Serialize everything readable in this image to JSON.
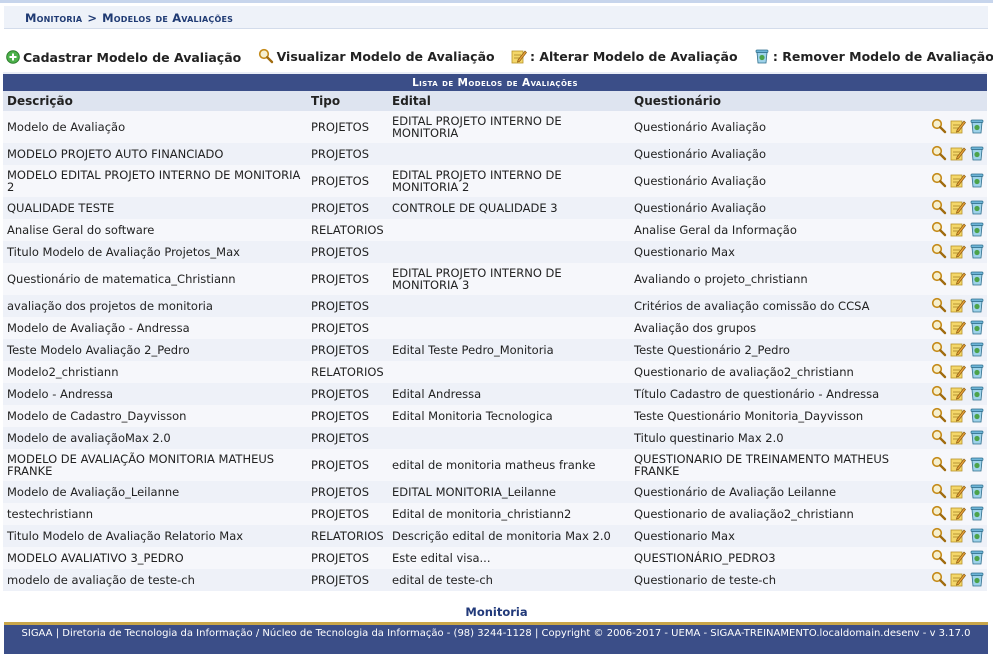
{
  "breadcrumb": {
    "module": "Monitoria",
    "separator": ">",
    "page": "Modelos de Avaliações"
  },
  "actions": {
    "register": "Cadastrar Modelo de Avaliação",
    "view": "Visualizar Modelo de Avaliação",
    "edit": ": Alterar Modelo de Avaliação",
    "remove": ": Remover Modelo de Avaliação"
  },
  "table": {
    "caption": "Lista de Modelos de Avaliações",
    "headers": {
      "descricao": "Descrição",
      "tipo": "Tipo",
      "edital": "Edital",
      "questionario": "Questionário"
    },
    "rows": [
      {
        "descricao": "Modelo de Avaliação",
        "tipo": "PROJETOS",
        "edital": "EDITAL PROJETO INTERNO DE MONITORIA",
        "questionario": "Questionário Avaliação"
      },
      {
        "descricao": "MODELO PROJETO AUTO FINANCIADO",
        "tipo": "PROJETOS",
        "edital": "",
        "questionario": "Questionário Avaliação"
      },
      {
        "descricao": "MODELO EDITAL PROJETO INTERNO DE MONITORIA 2",
        "tipo": "PROJETOS",
        "edital": "EDITAL PROJETO INTERNO DE MONITORIA 2",
        "questionario": "Questionário Avaliação"
      },
      {
        "descricao": "QUALIDADE TESTE",
        "tipo": "PROJETOS",
        "edital": "CONTROLE DE QUALIDADE 3",
        "questionario": "Questionário Avaliação"
      },
      {
        "descricao": "Analise Geral do software",
        "tipo": "RELATORIOS",
        "edital": "",
        "questionario": "Analise Geral da Informação"
      },
      {
        "descricao": "Titulo Modelo de Avaliação Projetos_Max",
        "tipo": "PROJETOS",
        "edital": "",
        "questionario": "Questionario Max"
      },
      {
        "descricao": "Questionário de matematica_Christiann",
        "tipo": "PROJETOS",
        "edital": "EDITAL PROJETO INTERNO DE MONITORIA 3",
        "questionario": "Avaliando o projeto_christiann"
      },
      {
        "descricao": "avaliação dos projetos de monitoria",
        "tipo": "PROJETOS",
        "edital": "",
        "questionario": "Critérios de avaliação comissão do CCSA"
      },
      {
        "descricao": "Modelo de Avaliação - Andressa",
        "tipo": "PROJETOS",
        "edital": "",
        "questionario": "Avaliação dos grupos"
      },
      {
        "descricao": "Teste Modelo Avaliação 2_Pedro",
        "tipo": "PROJETOS",
        "edital": "Edital Teste Pedro_Monitoria",
        "questionario": "Teste Questionário 2_Pedro"
      },
      {
        "descricao": "Modelo2_christiann",
        "tipo": "RELATORIOS",
        "edital": "",
        "questionario": "Questionario de avaliação2_christiann"
      },
      {
        "descricao": "Modelo - Andressa",
        "tipo": "PROJETOS",
        "edital": "Edital Andressa",
        "questionario": "Título Cadastro de questionário - Andressa"
      },
      {
        "descricao": "Modelo de Cadastro_Dayvisson",
        "tipo": "PROJETOS",
        "edital": "Edital Monitoria Tecnologica",
        "questionario": "Teste Questionário Monitoria_Dayvisson"
      },
      {
        "descricao": "Modelo de avaliaçãoMax 2.0",
        "tipo": "PROJETOS",
        "edital": "",
        "questionario": "Titulo questinario Max 2.0"
      },
      {
        "descricao": "MODELO DE AVALIAÇÃO MONITORIA MATHEUS FRANKE",
        "tipo": "PROJETOS",
        "edital": "edital de monitoria matheus franke",
        "questionario": "QUESTIONARIO DE TREINAMENTO MATHEUS FRANKE"
      },
      {
        "descricao": "Modelo de Avaliação_Leilanne",
        "tipo": "PROJETOS",
        "edital": "EDITAL MONITORIA_Leilanne",
        "questionario": "Questionário de Avaliação Leilanne"
      },
      {
        "descricao": "testechristiann",
        "tipo": "PROJETOS",
        "edital": "Edital de monitoria_christiann2",
        "questionario": "Questionario de avaliação2_christiann"
      },
      {
        "descricao": "Titulo Modelo de Avaliação Relatorio Max",
        "tipo": "RELATORIOS",
        "edital": "Descrição edital de monitoria Max 2.0",
        "questionario": "Questionario Max"
      },
      {
        "descricao": "MODELO AVALIATIVO 3_PEDRO",
        "tipo": "PROJETOS",
        "edital": "Este edital visa...",
        "questionario": "QUESTIONÁRIO_PEDRO3"
      },
      {
        "descricao": "modelo de avaliação de teste-ch",
        "tipo": "PROJETOS",
        "edital": "edital de teste-ch",
        "questionario": "Questionario de teste-ch"
      }
    ]
  },
  "footer": {
    "title": "Monitoria",
    "text": "SIGAA | Diretoria de Tecnologia da Informação / Núcleo de Tecnologia da Informação - (98) 3244-1128 | Copyright © 2006-2017 - UEMA - SIGAA-TREINAMENTO.localdomain.desenv - v 3.17.0"
  },
  "icons": [
    "plus-icon",
    "magnifier-icon",
    "pencil-icon",
    "trash-icon"
  ],
  "colors": {
    "header_blue": "#3b4e88",
    "breadcrumb_text": "#1f3a73",
    "column_header_bg": "#dee4f0",
    "footer_border": "#c9a64a"
  }
}
